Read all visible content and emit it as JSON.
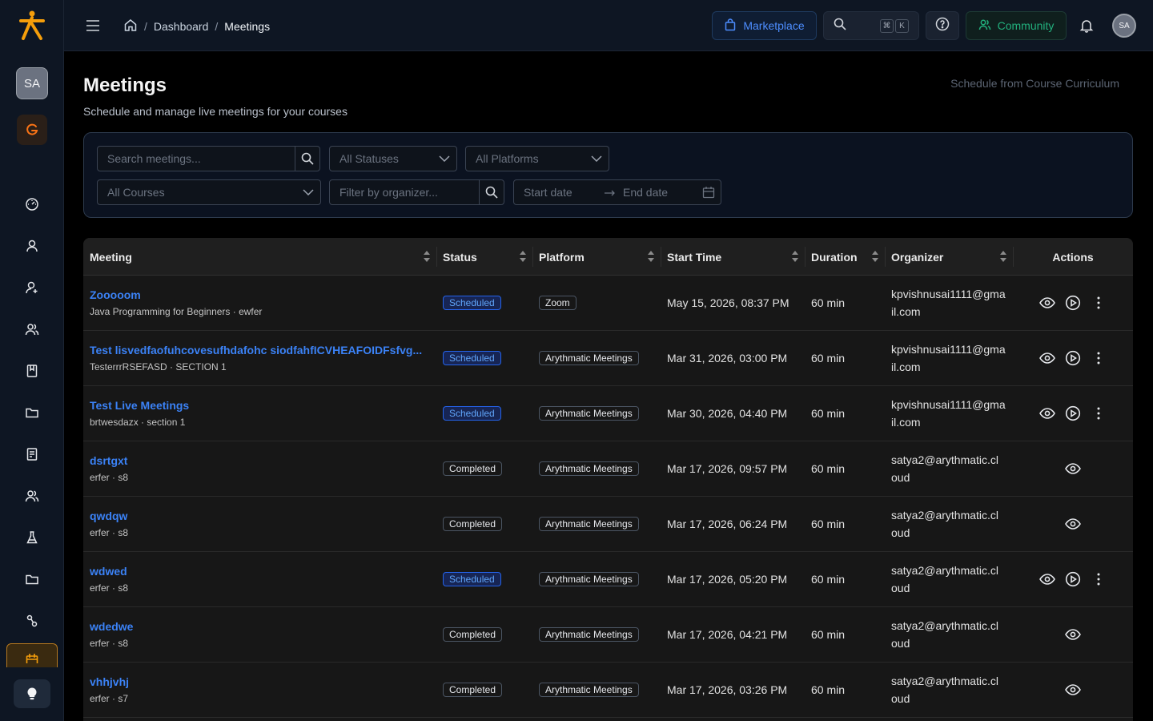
{
  "user": {
    "initials": "SA"
  },
  "breadcrumb": {
    "items": [
      {
        "label": "Dashboard"
      },
      {
        "label": "Meetings"
      }
    ]
  },
  "topbar": {
    "marketplace_label": "Marketplace",
    "kbd_cmd": "⌘",
    "kbd_k": "K",
    "community_label": "Community"
  },
  "page": {
    "title": "Meetings",
    "subtitle": "Schedule and manage live meetings for your courses",
    "schedule_link": "Schedule from Course Curriculum"
  },
  "filters": {
    "search_placeholder": "Search meetings...",
    "status_placeholder": "All Statuses",
    "platform_placeholder": "All Platforms",
    "courses_placeholder": "All Courses",
    "organizer_placeholder": "Filter by organizer...",
    "start_date_placeholder": "Start date",
    "end_date_placeholder": "End date"
  },
  "table": {
    "headers": [
      "Meeting",
      "Status",
      "Platform",
      "Start Time",
      "Duration",
      "Organizer",
      "Actions"
    ],
    "rows": [
      {
        "title": "Zooooom",
        "sub": "Java Programming for Beginners · ewfer",
        "status": "Scheduled",
        "platform": "Zoom",
        "start": "May 15, 2026, 08:37 PM",
        "duration": "60 min",
        "org1": "kpvishnusai1111@gma",
        "org2": "il.com"
      },
      {
        "title": "Test lisvedfaofuhcovesufhdafohc siodfahfICVHEAFOIDFsfvg...",
        "sub": "TesterrrRSEFASD · SECTION 1",
        "status": "Scheduled",
        "platform": "Arythmatic Meetings",
        "start": "Mar 31, 2026, 03:00 PM",
        "duration": "60 min",
        "org1": "kpvishnusai1111@gma",
        "org2": "il.com"
      },
      {
        "title": "Test Live Meetings",
        "sub": "brtwesdazx · section 1",
        "status": "Scheduled",
        "platform": "Arythmatic Meetings",
        "start": "Mar 30, 2026, 04:40 PM",
        "duration": "60 min",
        "org1": "kpvishnusai1111@gma",
        "org2": "il.com"
      },
      {
        "title": "dsrtgxt",
        "sub": "erfer · s8",
        "status": "Completed",
        "platform": "Arythmatic Meetings",
        "start": "Mar 17, 2026, 09:57 PM",
        "duration": "60 min",
        "org1": "satya2@arythmatic.cl",
        "org2": "oud"
      },
      {
        "title": "qwdqw",
        "sub": "erfer · s8",
        "status": "Completed",
        "platform": "Arythmatic Meetings",
        "start": "Mar 17, 2026, 06:24 PM",
        "duration": "60 min",
        "org1": "satya2@arythmatic.cl",
        "org2": "oud"
      },
      {
        "title": "wdwed",
        "sub": "erfer · s8",
        "status": "Scheduled",
        "platform": "Arythmatic Meetings",
        "start": "Mar 17, 2026, 05:20 PM",
        "duration": "60 min",
        "org1": "satya2@arythmatic.cl",
        "org2": "oud"
      },
      {
        "title": "wdedwe",
        "sub": "erfer · s8",
        "status": "Completed",
        "platform": "Arythmatic Meetings",
        "start": "Mar 17, 2026, 04:21 PM",
        "duration": "60 min",
        "org1": "satya2@arythmatic.cl",
        "org2": "oud"
      },
      {
        "title": "vhhjvhj",
        "sub": "erfer · s7",
        "status": "Completed",
        "platform": "Arythmatic Meetings",
        "start": "Mar 17, 2026, 03:26 PM",
        "duration": "60 min",
        "org1": "satya2@arythmatic.cl",
        "org2": "oud"
      }
    ]
  },
  "colors": {
    "accent": "#3b82f6",
    "brand": "#f59e0b",
    "success": "#22b07d"
  },
  "icons": {
    "sidebar": [
      "dashboard-icon",
      "user-icon",
      "user-add-icon",
      "users-icon",
      "book-icon",
      "folder-icon",
      "document-icon",
      "group-icon",
      "flask-icon",
      "folder-icon",
      "link-icon",
      "calendar-icon",
      "bulb-icon"
    ],
    "row_actions": [
      "eye-icon",
      "play-icon",
      "more-vertical-icon"
    ]
  }
}
